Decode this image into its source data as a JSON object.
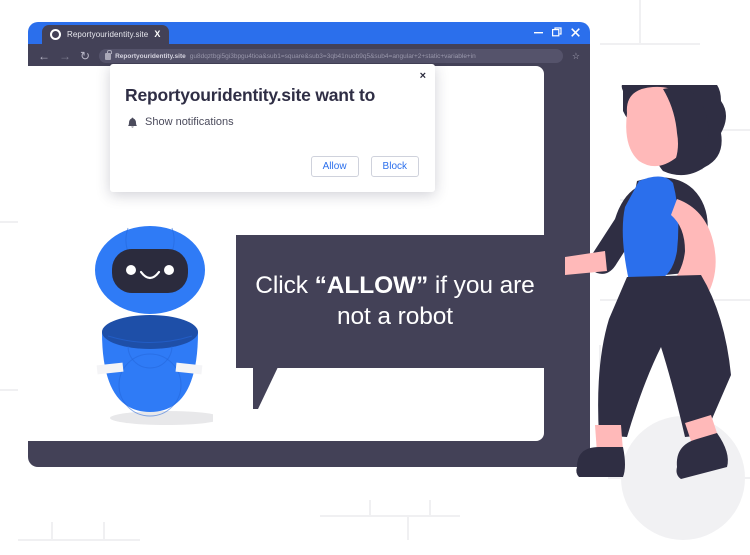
{
  "browser": {
    "tab": {
      "title": "Reportyouridentity.site",
      "close_label": "X",
      "favicon": "globe-icon"
    },
    "window_controls": {
      "minimize": "−",
      "maximize": "❐",
      "close": "✕"
    },
    "toolbar": {
      "back": "←",
      "forward": "→",
      "reload": "↻",
      "lock": "lock-icon",
      "bookmark": "☆",
      "url_domain": "Reportyouridentity.site",
      "url_path": "gu8dqztbgi5gi3bpgu4tioa&sub1=square&sub3=3qb41nuob9q5&sub4=angular+2+static+variable+in"
    }
  },
  "dialog": {
    "title": "Reportyouridentity.site want to",
    "close": "×",
    "permission_icon": "bell-icon",
    "permission_label": "Show notifications",
    "allow_label": "Allow",
    "block_label": "Block"
  },
  "speech_bubble": {
    "line1_pre": "Click ",
    "line1_emphasis": "“ALLOW”",
    "line1_post": " if you are",
    "line2": "not a robot"
  },
  "characters": {
    "robot": "friendly-blue-robot",
    "person": "walking-person-illustration"
  },
  "colors": {
    "accent_blue": "#2b6fec",
    "dark_navy": "#434157",
    "robot_blue": "#2f7bf6",
    "robot_dark": "#2b2b3d",
    "skin": "#ffb9b9",
    "hair": "#2f2e43",
    "page_white": "#ffffff",
    "link_blue": "#2b6fec",
    "bg_line": "#f0f0f2"
  }
}
